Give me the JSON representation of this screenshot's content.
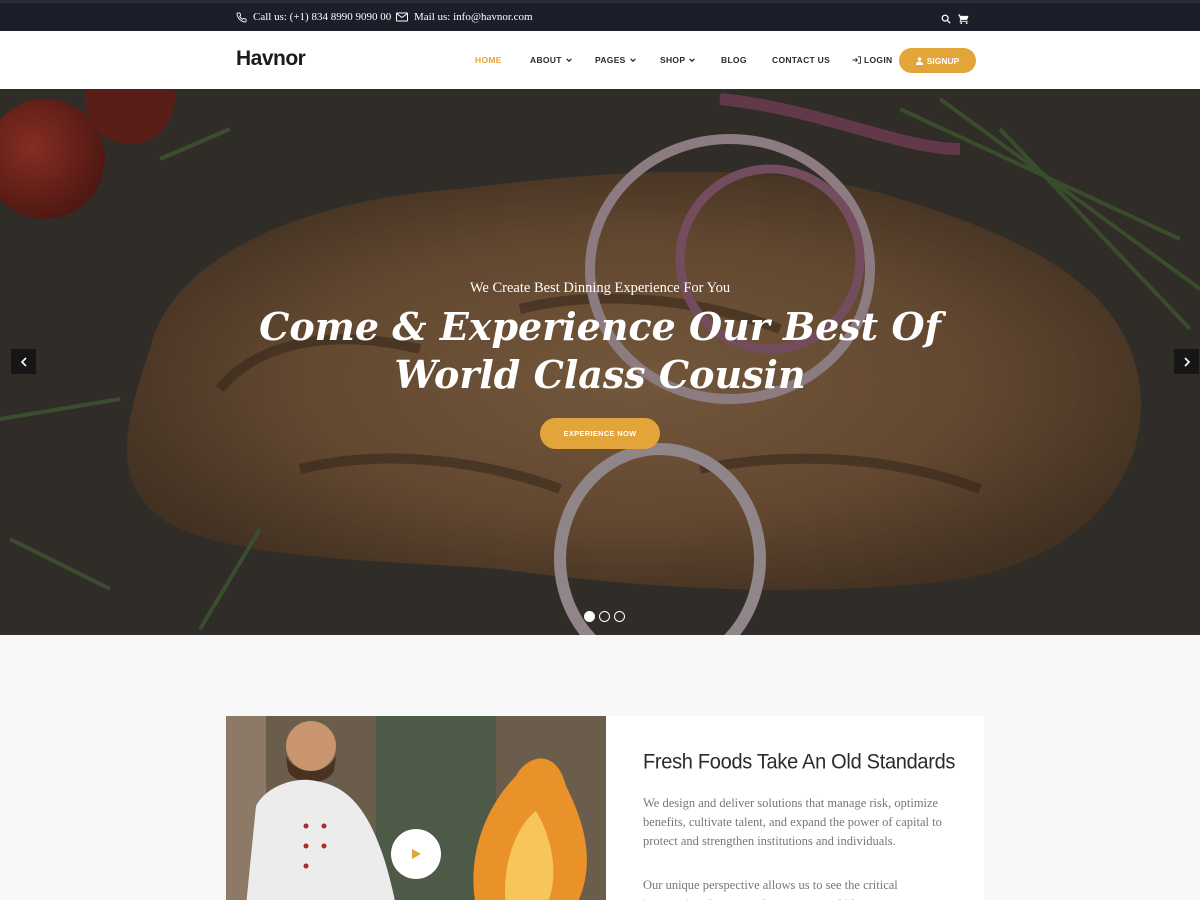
{
  "topbar": {
    "phone_text": "Call us: (+1) 834 8990 9090 00",
    "mail_text": "Mail us: info@havnor.com",
    "icons": [
      "phone-icon",
      "mail-icon",
      "search-icon",
      "cart-icon"
    ]
  },
  "nav": {
    "logo": "Havnor",
    "items": [
      {
        "label": "HOME",
        "active": true
      },
      {
        "label": "ABOUT",
        "dropdown": true
      },
      {
        "label": "PAGES",
        "dropdown": true
      },
      {
        "label": "SHOP",
        "dropdown": true
      },
      {
        "label": "BLOG"
      },
      {
        "label": "CONTACT US"
      }
    ],
    "login": "LOGIN",
    "signup": "SIGNUP"
  },
  "hero": {
    "subtitle": "We Create Best Dinning Experience For You",
    "title_line1": "Come & Experience Our Best Of",
    "title_line2": "World Class Cousin",
    "button": "EXPERIENCE NOW",
    "slides": 3,
    "active_slide": 1
  },
  "about": {
    "heading": "Fresh Foods Take An Old Standards",
    "para1": "We design and deliver solutions that manage risk, optimize benefits, cultivate talent, and expand the power of capital to protect and strengthen institutions and individuals.",
    "para2": "Our unique perspective allows us to see the critical intersections between talent, assets, and ideas."
  },
  "colors": {
    "accent": "#e3a43a",
    "topbar_bg": "#1c1f2a",
    "section_bg": "#f7f7f7"
  }
}
